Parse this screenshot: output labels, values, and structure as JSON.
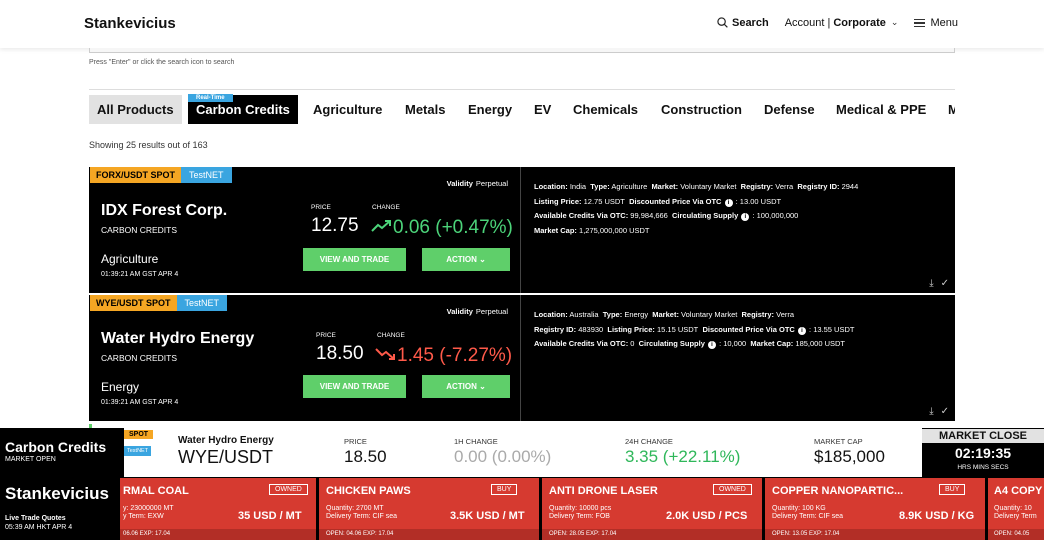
{
  "header": {
    "brand": "Stankevicius",
    "search_label": "Search",
    "account_label": "Account |",
    "account_type": "Corporate",
    "menu_label": "Menu"
  },
  "search": {
    "hint": "Press \"Enter\" or click the search icon to search"
  },
  "tabs": {
    "realtime_badge": "Real-Time",
    "items": [
      "All Products",
      "Carbon Credits",
      "Agriculture",
      "Metals",
      "Energy",
      "EV",
      "Chemicals",
      "Construction",
      "Defense",
      "Medical & PPE",
      "M"
    ]
  },
  "results": {
    "showing": "Showing 25 results out of 163"
  },
  "listings": [
    {
      "pair": "FORX/USDT SPOT",
      "net": "TestNET",
      "validity_label": "Validity",
      "validity": "Perpetual",
      "name": "IDX Forest Corp.",
      "type": "CARBON CREDITS",
      "sector": "Agriculture",
      "time": "01:39:21 AM GST APR 4",
      "price_label": "PRICE",
      "change_label": "CHANGE",
      "price": "12.75",
      "change": "0.06 (+0.47%)",
      "direction": "up",
      "trade_label": "VIEW AND TRADE",
      "action_label": "ACTION",
      "details": [
        [
          [
            "Location:",
            "India"
          ],
          [
            "Type:",
            "Agriculture"
          ],
          [
            "Market:",
            "Voluntary Market"
          ],
          [
            "Registry:",
            "Verra"
          ],
          [
            "Registry ID:",
            "2944"
          ]
        ],
        [
          [
            "Listing Price:",
            "12.75 USDT"
          ],
          [
            "Discounted Price Via OTC",
            ": 13.00 USDT",
            "i"
          ]
        ],
        [
          [
            "Available Credits Via OTC:",
            "99,984,666"
          ],
          [
            "Circulating Supply",
            ": 100,000,000",
            "i"
          ]
        ],
        [
          [
            "Market Cap:",
            "1,275,000,000 USDT"
          ]
        ]
      ]
    },
    {
      "pair": "WYE/USDT SPOT",
      "net": "TestNET",
      "validity_label": "Validity",
      "validity": "Perpetual",
      "name": "Water Hydro Energy",
      "type": "CARBON CREDITS",
      "sector": "Energy",
      "time": "01:39:21 AM GST APR 4",
      "price_label": "PRICE",
      "change_label": "CHANGE",
      "price": "18.50",
      "change": "1.45 (-7.27%)",
      "direction": "down",
      "trade_label": "VIEW AND TRADE",
      "action_label": "ACTION",
      "details": [
        [
          [
            "Location:",
            "Australia"
          ],
          [
            "Type:",
            "Energy"
          ],
          [
            "Market:",
            "Voluntary Market"
          ],
          [
            "Registry:",
            "Verra"
          ]
        ],
        [
          [
            "Registry ID:",
            "483930"
          ],
          [
            "Listing Price:",
            "15.15 USDT"
          ],
          [
            "Discounted Price Via OTC",
            ": 13.55 USDT",
            "i"
          ]
        ],
        [
          [
            "Available Credits Via OTC:",
            "0"
          ],
          [
            "Circulating Supply",
            ": 10,000",
            "i"
          ],
          [
            "Market Cap:",
            "185,000 USDT"
          ]
        ]
      ]
    }
  ],
  "ticker": {
    "section_title": "Carbon Credits",
    "market_status": "MARKET OPEN",
    "spot": "SPOT",
    "net": "TestNET",
    "name": "Water Hydro Energy",
    "pair": "WYE/USDT",
    "price_label": "PRICE",
    "price": "18.50",
    "h1_label": "1H CHANGE",
    "h1_value": "0.00 (0.00%)",
    "h24_label": "24H CHANGE",
    "h24_value": "3.35 (+22.11%)",
    "cap_label": "MARKET CAP",
    "cap_value": "$185,000",
    "close_label": "MARKET CLOSE",
    "close_time": "02:19:35",
    "close_units": "HRS MINS SECS",
    "brand": "Stankevicius",
    "live_label": "Live Trade Quotes",
    "live_time": "05:39 AM HKT APR 4",
    "cards": [
      {
        "name": "RMAL COAL",
        "btn": "OWNED",
        "qty": "y: 23000000 MT",
        "term": "y Term: EXW",
        "price": "35 USD / MT",
        "open": "06.06  EXP: 17.04"
      },
      {
        "name": "CHICKEN PAWS",
        "btn": "BUY",
        "qty": "Quantity: 2700 MT",
        "term": "Delivery Term: CIF sea",
        "price": "3.5K USD / MT",
        "open": "OPEN: 04.06  EXP: 17.04"
      },
      {
        "name": "ANTI DRONE LASER",
        "btn": "OWNED",
        "qty": "Quantity: 10000 pcs",
        "term": "Delivery Term: FOB",
        "price": "2.0K USD / PCS",
        "open": "OPEN: 28.05  EXP: 17.04"
      },
      {
        "name": "COPPER NANOPARTIC...",
        "btn": "BUY",
        "qty": "Quantity: 100 KG",
        "term": "Delivery Term: CIF sea",
        "price": "8.9K USD / KG",
        "open": "OPEN: 13.05  EXP: 17.04"
      },
      {
        "name": "A4 COPY",
        "btn": "",
        "qty": "Quantity: 10",
        "term": "Delivery Term",
        "price": "",
        "open": "OPEN: 04.05"
      }
    ]
  }
}
